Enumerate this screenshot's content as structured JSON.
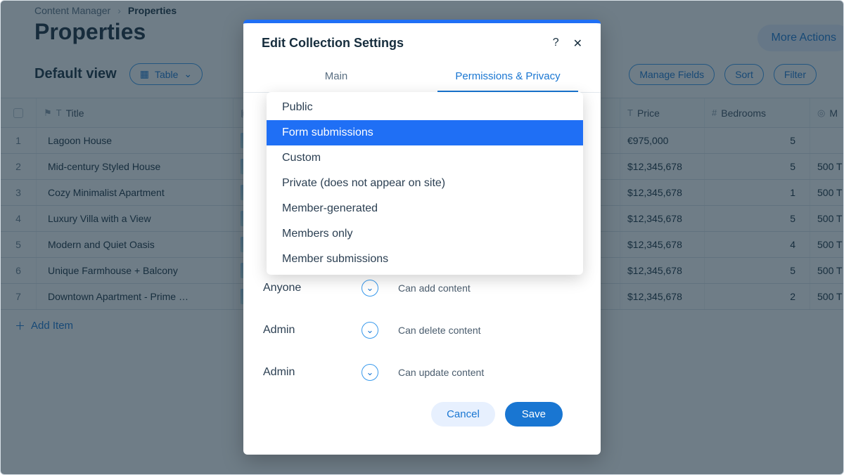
{
  "breadcrumb": {
    "root": "Content Manager",
    "current": "Properties"
  },
  "page": {
    "title": "Properties",
    "view_label": "Default view",
    "table_switch": "Table",
    "add_item": "Add Item",
    "more_actions": "More Actions"
  },
  "toolbar_buttons": {
    "manage_fields": "Manage Fields",
    "sort": "Sort",
    "filter": "Filter"
  },
  "columns": {
    "title": "Title",
    "image": "",
    "price": "Price",
    "bedrooms": "Bedrooms",
    "sq": "M"
  },
  "rows": [
    {
      "n": "1",
      "title": "Lagoon House",
      "price": "€975,000",
      "bedrooms": "5",
      "sq": ""
    },
    {
      "n": "2",
      "title": "Mid-century Styled House",
      "price": "$12,345,678",
      "bedrooms": "5",
      "sq": "500 T"
    },
    {
      "n": "3",
      "title": "Cozy Minimalist Apartment",
      "price": "$12,345,678",
      "bedrooms": "1",
      "sq": "500 T"
    },
    {
      "n": "4",
      "title": "Luxury Villa with a View",
      "price": "$12,345,678",
      "bedrooms": "5",
      "sq": "500 T"
    },
    {
      "n": "5",
      "title": "Modern and Quiet Oasis",
      "price": "$12,345,678",
      "bedrooms": "4",
      "sq": "500 T"
    },
    {
      "n": "6",
      "title": "Unique Farmhouse + Balcony",
      "price": "$12,345,678",
      "bedrooms": "5",
      "sq": "500 T"
    },
    {
      "n": "7",
      "title": "Downtown Apartment - Prime …",
      "price": "$12,345,678",
      "bedrooms": "2",
      "sq": "500 T"
    }
  ],
  "modal": {
    "title": "Edit Collection Settings",
    "tabs": {
      "main": "Main",
      "permissions": "Permissions & Privacy"
    },
    "perm_rows": [
      {
        "role": "Anyone",
        "desc": "Can add content"
      },
      {
        "role": "Admin",
        "desc": "Can delete content"
      },
      {
        "role": "Admin",
        "desc": "Can update content"
      }
    ],
    "cancel": "Cancel",
    "save": "Save"
  },
  "dropdown": {
    "options": [
      "Public",
      "Form submissions",
      "Custom",
      "Private (does not appear on site)",
      "Member-generated",
      "Members only",
      "Member submissions"
    ],
    "selected_index": 1
  }
}
